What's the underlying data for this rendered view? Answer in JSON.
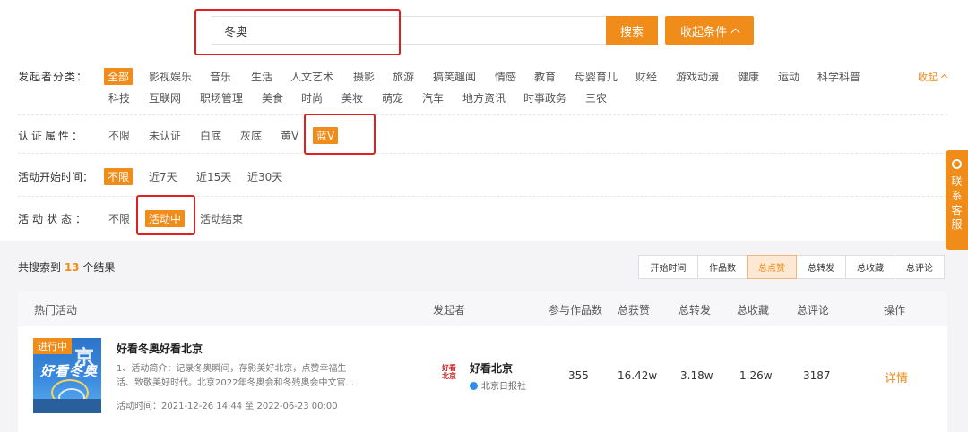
{
  "search": {
    "value": "冬奥",
    "button": "搜索",
    "collapse": "收起条件"
  },
  "filters": {
    "category": {
      "label": "发起者分类：",
      "options": [
        "全部",
        "影视娱乐",
        "音乐",
        "生活",
        "人文艺术",
        "摄影",
        "旅游",
        "搞笑趣闻",
        "情感",
        "教育",
        "母婴育儿",
        "财经",
        "游戏动漫",
        "健康",
        "运动",
        "科学科普",
        "科技",
        "互联网",
        "职场管理",
        "美食",
        "时尚",
        "美妆",
        "萌宠",
        "汽车",
        "地方资讯",
        "时事政务",
        "三农"
      ],
      "selected": "全部",
      "fold": "收起"
    },
    "verify": {
      "label": "认证属性：",
      "options": [
        "不限",
        "未认证",
        "白底",
        "灰底",
        "黄V",
        "蓝V"
      ],
      "selected": "蓝V"
    },
    "start_time": {
      "label": "活动开始时间：",
      "options": [
        "不限",
        "近7天",
        "近15天",
        "近30天"
      ],
      "selected": "不限"
    },
    "status": {
      "label": "活动状态：",
      "options": [
        "不限",
        "活动中",
        "活动结束"
      ],
      "selected": "活动中"
    }
  },
  "service": {
    "label": "联系客服"
  },
  "results": {
    "prefix": "共搜索到 ",
    "count": "13",
    "suffix": " 个结果",
    "sort_options": [
      "开始时间",
      "作品数",
      "总点赞",
      "总转发",
      "总收藏",
      "总评论"
    ],
    "sort_selected": "总点赞"
  },
  "table": {
    "headers": [
      "热门活动",
      "发起者",
      "参与作品数",
      "总获赞",
      "总转发",
      "总收藏",
      "总评论",
      "操作"
    ],
    "rows": [
      {
        "badge": "进行中",
        "title": "好看冬奥好看北京",
        "description": "1、活动简介：记录冬奥瞬间，存影美好北京，点赞幸福生活、致敬美好时代。北京2022年冬奥会和冬残奥会中文官...",
        "time": "活动时间：2021-12-26 14:44 至 2022-06-23 00:00",
        "publisher": "好看北京",
        "publisher_verified": "北京日报社",
        "works": "355",
        "likes": "16.42w",
        "forwards": "3.18w",
        "favorites": "1.26w",
        "comments": "3187",
        "action": "详情"
      }
    ]
  },
  "colors": {
    "accent": "#f08c1a",
    "annotation": "#e02020",
    "verified": "#2f8fe6"
  }
}
